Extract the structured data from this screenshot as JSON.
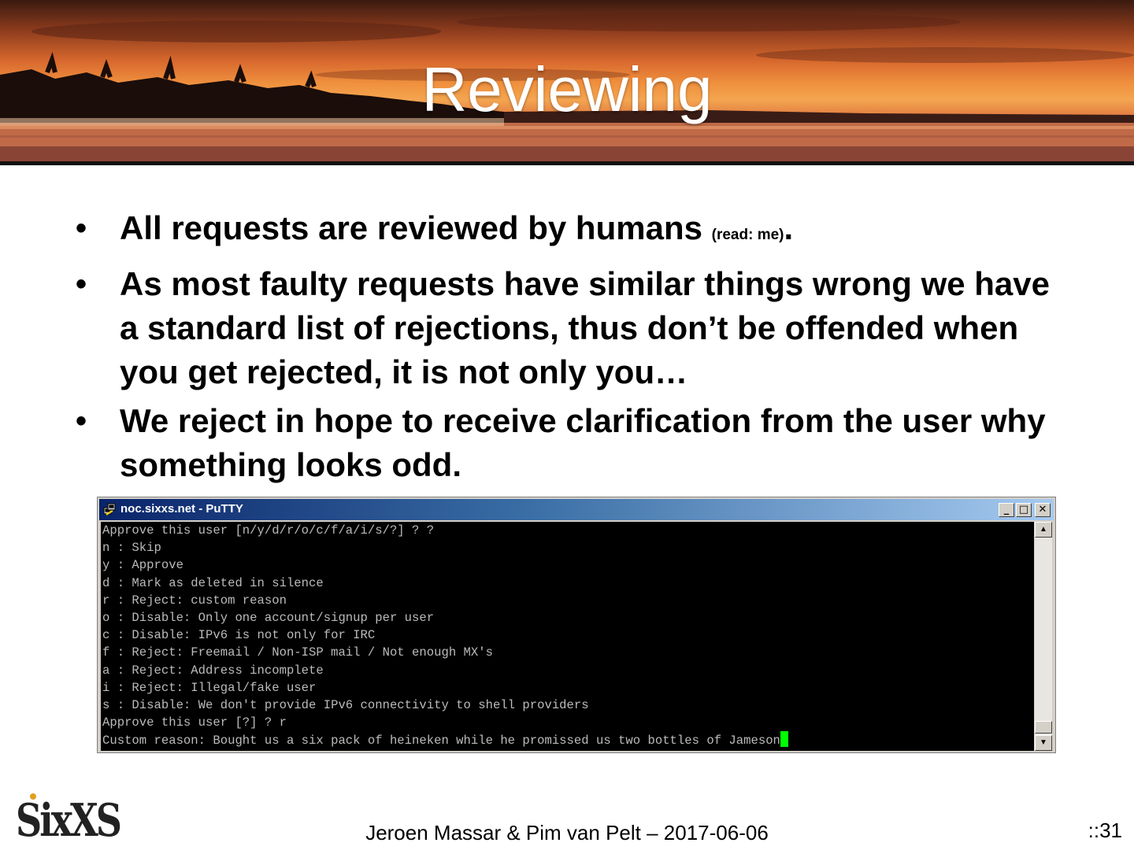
{
  "slide": {
    "title": "Reviewing",
    "bullets": [
      {
        "text": "All requests are reviewed by humans ",
        "small": "(read: me)",
        "tail": "."
      },
      {
        "text": "As most faulty requests have similar things wrong we have a standard list of rejections, thus don’t be offended when you get rejected, it is not only you…"
      },
      {
        "text": "We reject in hope to receive clarification from the user why something looks odd."
      }
    ]
  },
  "window": {
    "title": "noc.sixxs.net - PuTTY",
    "minimize_label": "_",
    "maximize_label": "□",
    "close_label": "✕",
    "scroll_up_label": "▲",
    "scroll_down_label": "▼",
    "terminal_lines": [
      "Approve this user [n/y/d/r/o/c/f/a/i/s/?] ? ?",
      "n : Skip",
      "y : Approve",
      "d : Mark as deleted in silence",
      "r : Reject: custom reason",
      "o : Disable: Only one account/signup per user",
      "c : Disable: IPv6 is not only for IRC",
      "f : Reject: Freemail / Non-ISP mail / Not enough MX's",
      "a : Reject: Address incomplete",
      "i : Reject: Illegal/fake user",
      "s : Disable: We don't provide IPv6 connectivity to shell providers",
      "Approve this user [?] ? r",
      "Custom reason: Bought us a six pack of heineken while he promissed us two bottles of Jameson"
    ],
    "cursor_color": "#00ff00"
  },
  "footer": {
    "logo": "SixXS",
    "credit": "Jeroen Massar & Pim van Pelt – 2017-06-06",
    "page": "::31"
  }
}
